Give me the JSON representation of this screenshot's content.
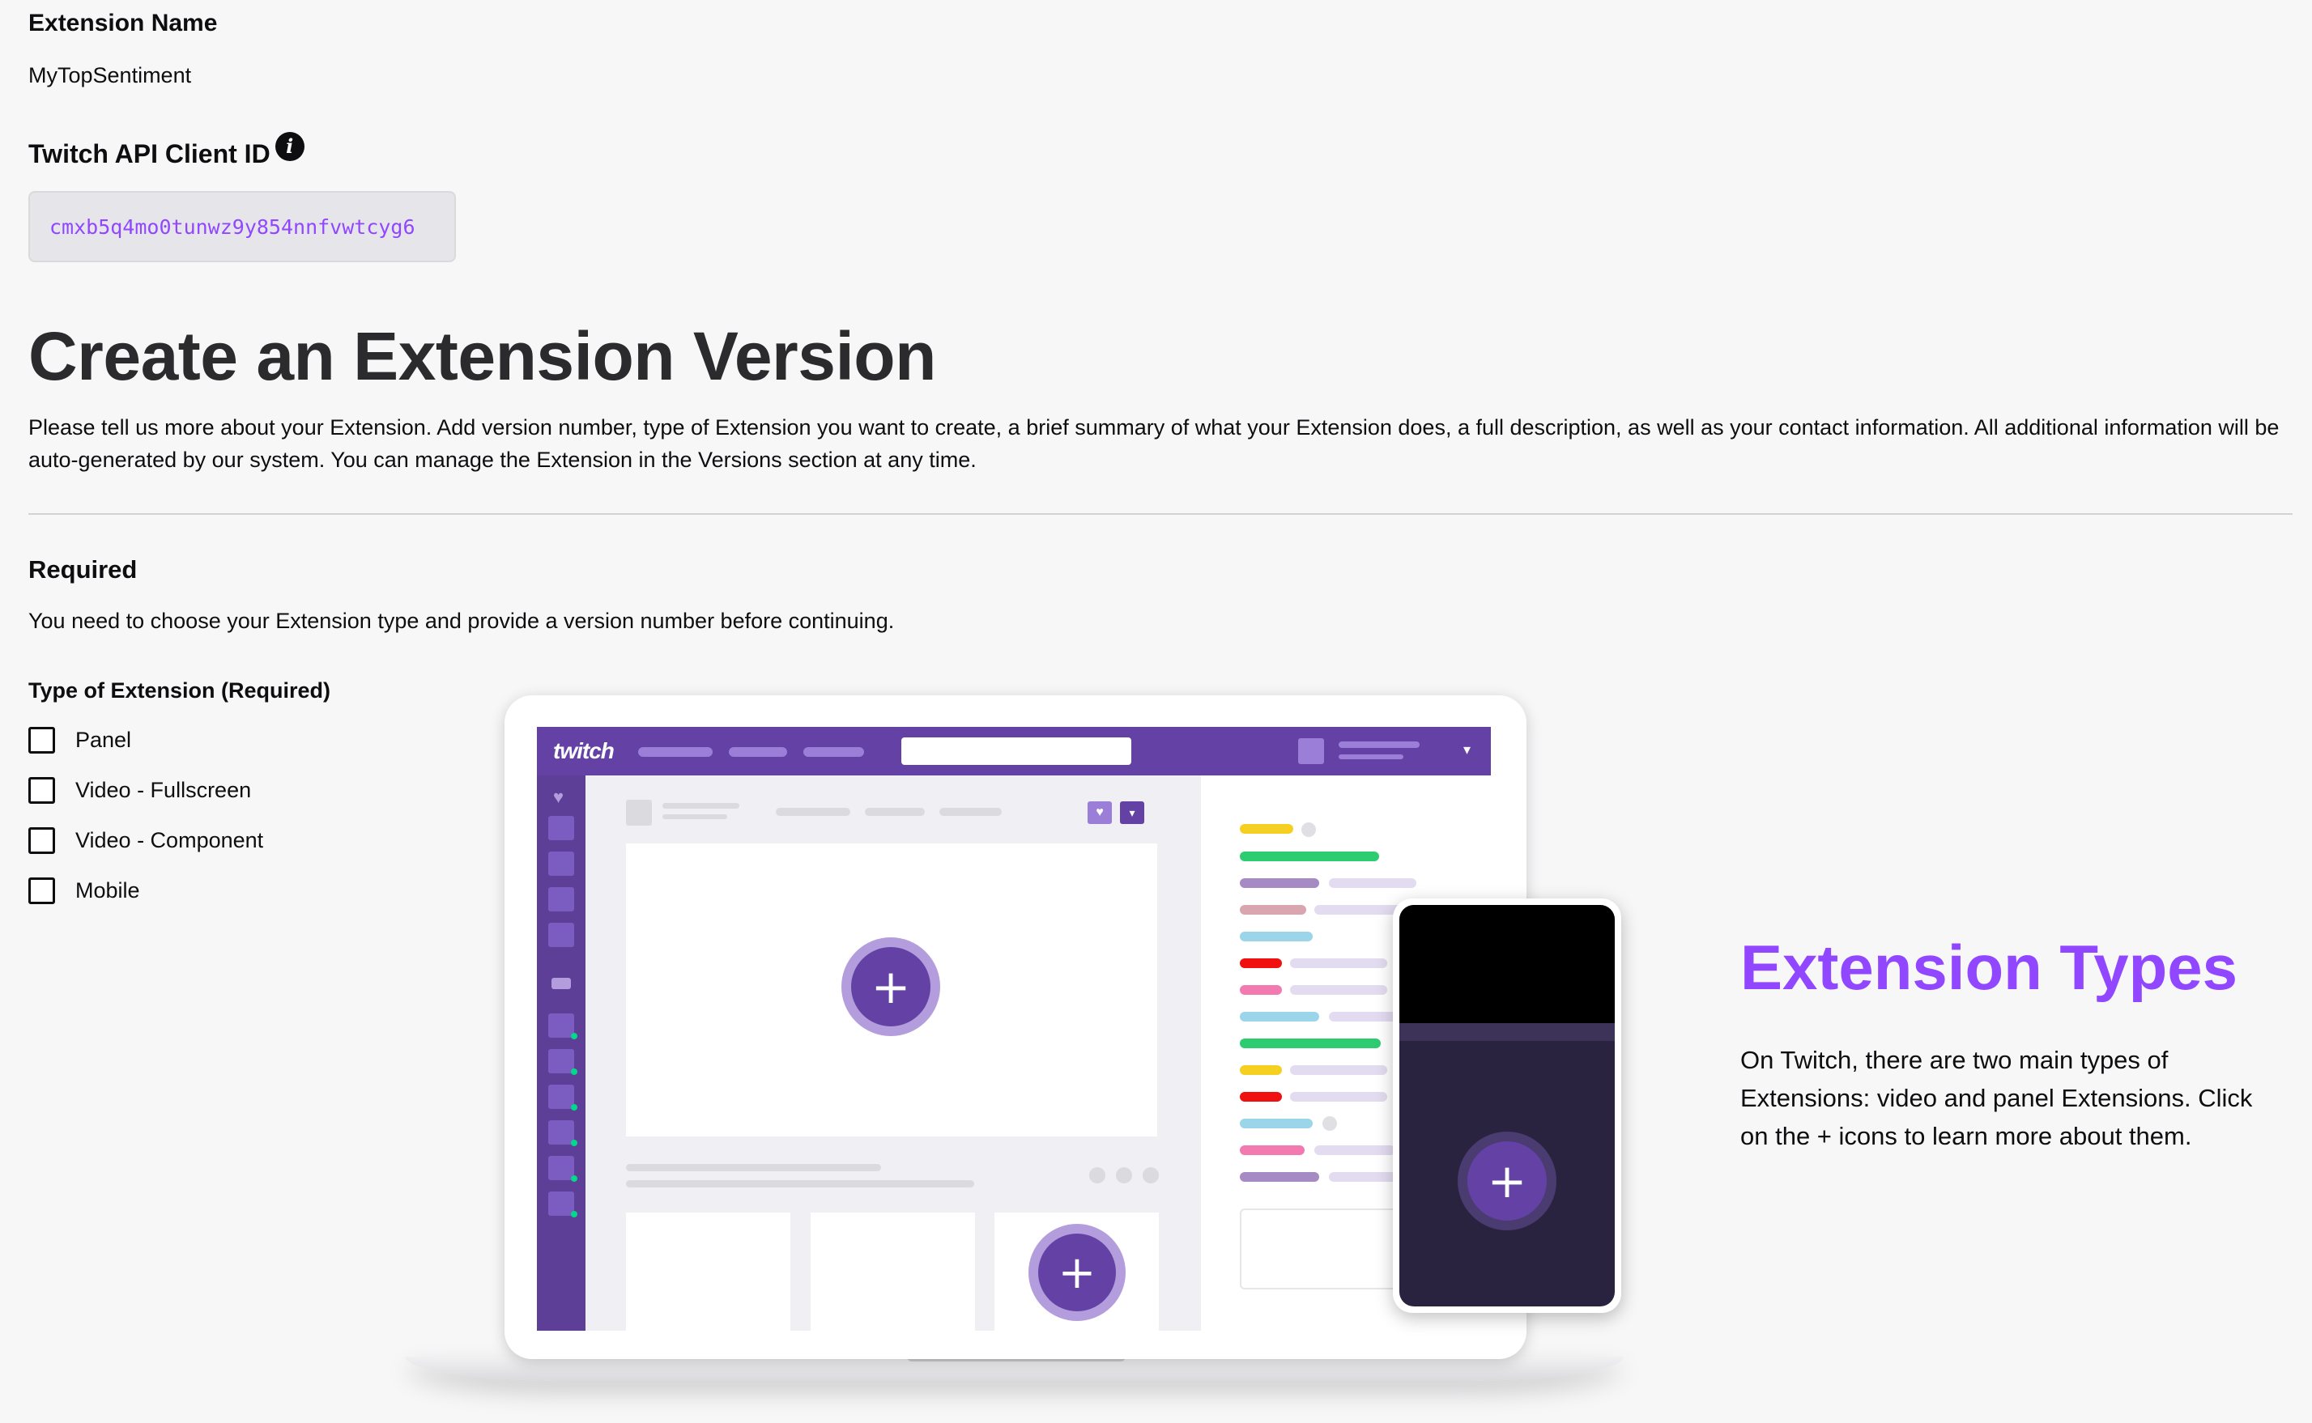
{
  "extension_name": {
    "label": "Extension Name",
    "value": "MyTopSentiment"
  },
  "client_id": {
    "label": "Twitch API Client ID",
    "value": "cmxb5q4mo0tunwz9y854nnfvwtcyg6",
    "info_icon": "info-icon"
  },
  "create_section": {
    "title": "Create an Extension Version",
    "intro": "Please tell us more about your Extension. Add version number, type of Extension you want to create, a brief summary of what your Extension does, a full description, as well as your contact information. All additional information will be auto-generated by our system. You can manage the Extension in the Versions section at any time."
  },
  "required": {
    "heading": "Required",
    "text": "You need to choose your Extension type and provide a version number before continuing.",
    "type_label": "Type of Extension (Required)",
    "options": [
      {
        "label": "Panel",
        "checked": false
      },
      {
        "label": "Video - Fullscreen",
        "checked": false
      },
      {
        "label": "Video - Component",
        "checked": false
      },
      {
        "label": "Mobile",
        "checked": false
      }
    ]
  },
  "illustration": {
    "logo_text": "twitch",
    "plus_symbol": "+"
  },
  "extension_types": {
    "title": "Extension Types",
    "text": "On Twitch, there are two main types of Extensions: video and panel Extensions. Click on the + icons to learn more about them."
  },
  "colors": {
    "accent": "#9146ff",
    "twitch_purple": "#6441a5",
    "mono_text": "#9147ff"
  }
}
